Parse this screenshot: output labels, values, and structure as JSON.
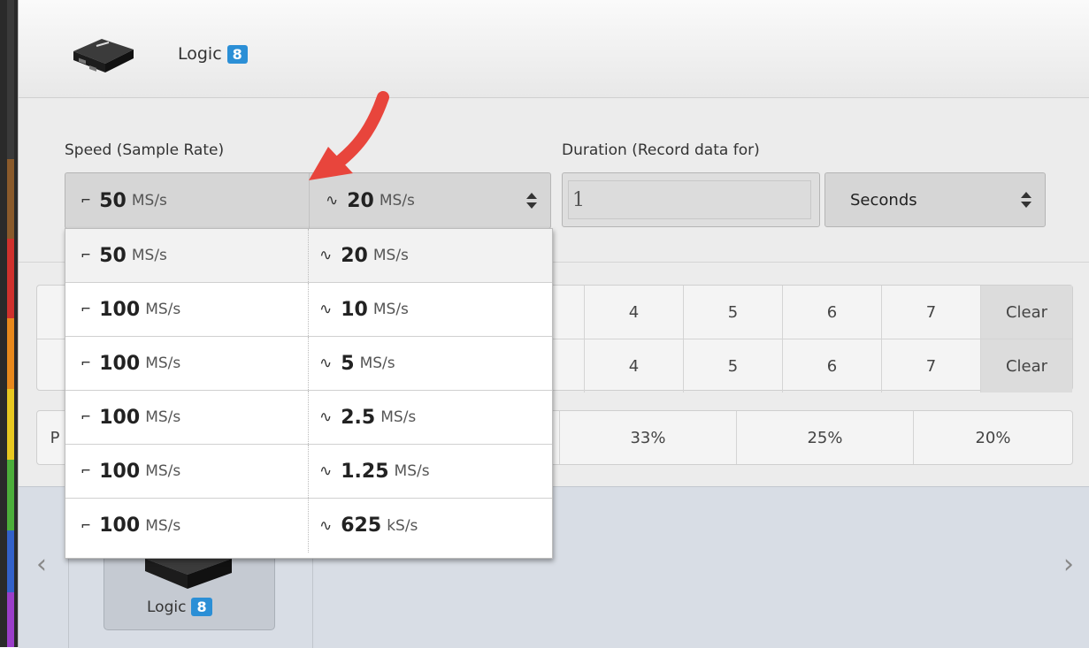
{
  "device": {
    "name": "Logic",
    "badge": "8"
  },
  "speed": {
    "label": "Speed (Sample Rate)",
    "digital_value": "50",
    "digital_unit": "MS/s",
    "analog_value": "20",
    "analog_unit": "MS/s",
    "digital_icon": "digital-step-icon",
    "analog_icon": "analog-wave-icon",
    "options": [
      {
        "digital_value": "50",
        "digital_unit": "MS/s",
        "analog_value": "20",
        "analog_unit": "MS/s",
        "selected": true
      },
      {
        "digital_value": "100",
        "digital_unit": "MS/s",
        "analog_value": "10",
        "analog_unit": "MS/s"
      },
      {
        "digital_value": "100",
        "digital_unit": "MS/s",
        "analog_value": "5",
        "analog_unit": "MS/s"
      },
      {
        "digital_value": "100",
        "digital_unit": "MS/s",
        "analog_value": "2.5",
        "analog_unit": "MS/s"
      },
      {
        "digital_value": "100",
        "digital_unit": "MS/s",
        "analog_value": "1.25",
        "analog_unit": "MS/s"
      },
      {
        "digital_value": "100",
        "digital_unit": "MS/s",
        "analog_value": "625",
        "analog_unit": "kS/s"
      }
    ]
  },
  "duration": {
    "label": "Duration (Record data for)",
    "value": "1",
    "unit": "Seconds"
  },
  "channels": {
    "row1": [
      "4",
      "5",
      "6",
      "7"
    ],
    "row2": [
      "4",
      "5",
      "6",
      "7"
    ],
    "clear_label": "Clear"
  },
  "percent": {
    "partial_label": "P",
    "values": [
      "33%",
      "25%",
      "20%"
    ]
  },
  "colors": {
    "accent": "#2b8fd6",
    "arrow": "#e8453c"
  }
}
